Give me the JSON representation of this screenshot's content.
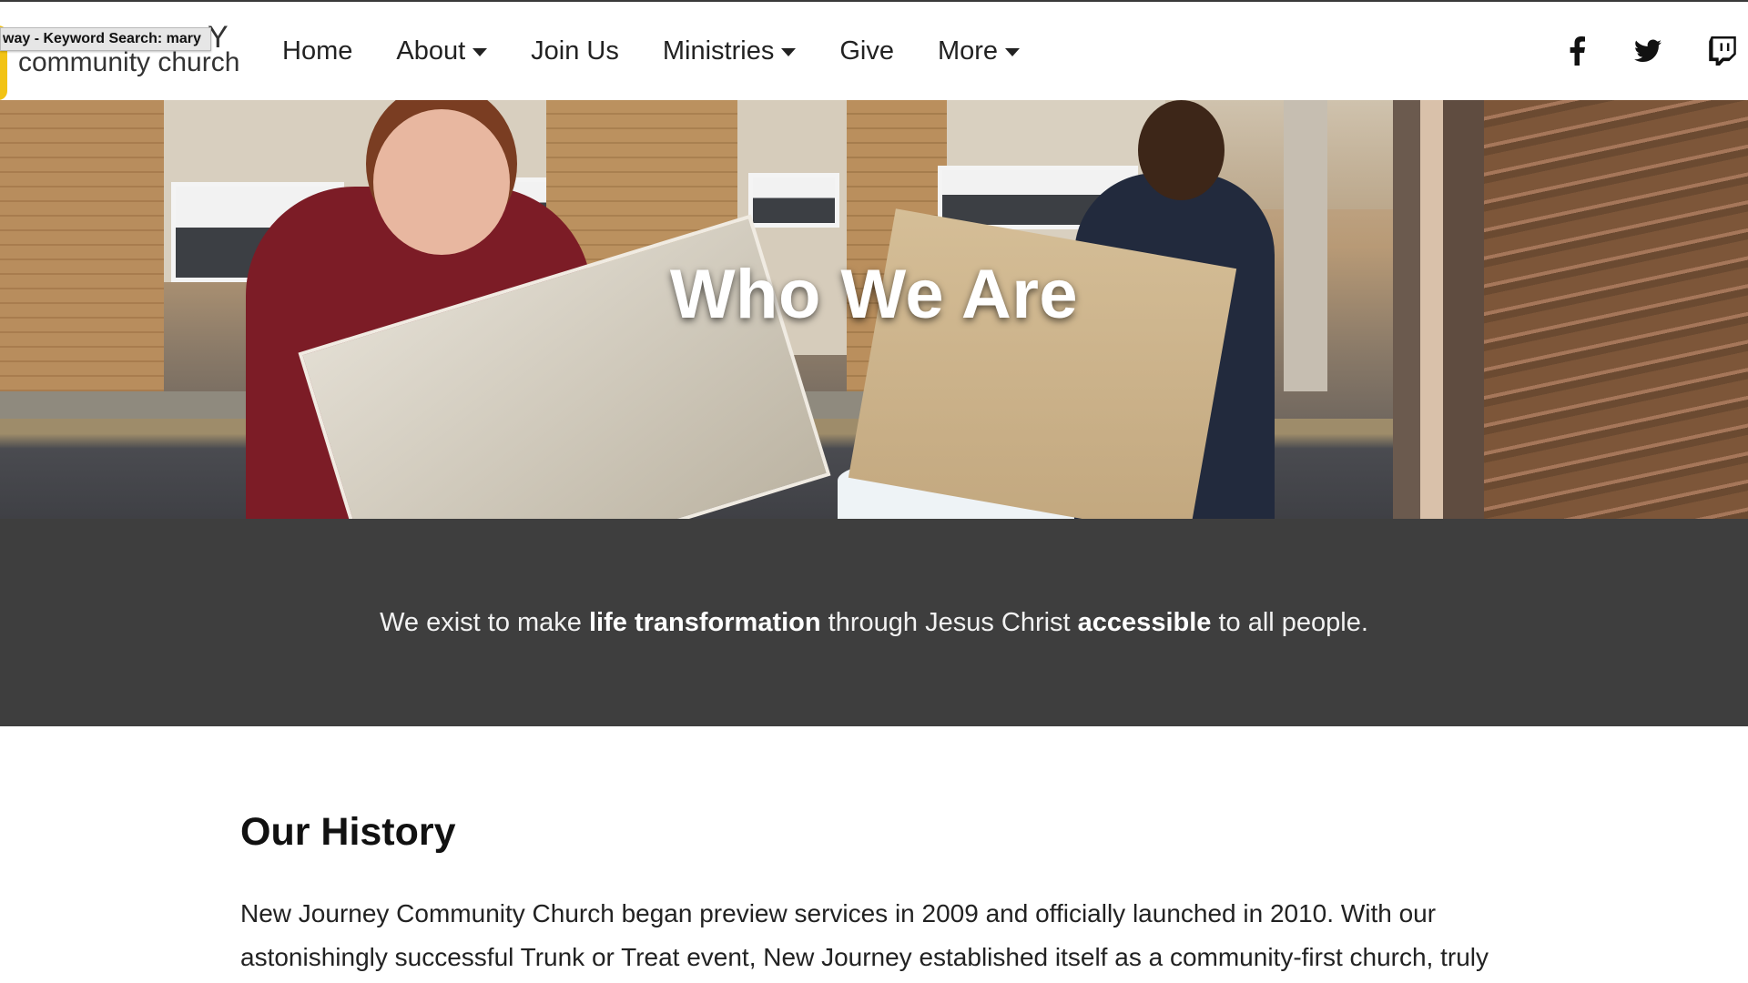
{
  "tooltip": "way - Keyword Search: mary",
  "logo": {
    "text_top": "Y",
    "text": "community church"
  },
  "nav": {
    "items": [
      {
        "label": "Home",
        "has_dropdown": false
      },
      {
        "label": "About",
        "has_dropdown": true
      },
      {
        "label": "Join Us",
        "has_dropdown": false
      },
      {
        "label": "Ministries",
        "has_dropdown": true
      },
      {
        "label": "Give",
        "has_dropdown": false
      },
      {
        "label": "More",
        "has_dropdown": true
      }
    ]
  },
  "social": {
    "icons": [
      "facebook-icon",
      "twitter-icon",
      "twitch-icon"
    ]
  },
  "hero": {
    "title": "Who We Are"
  },
  "mission": {
    "part1": "We exist to make ",
    "bold1": "life transformation",
    "part2": " through Jesus Christ ",
    "bold2": "accessible",
    "part3": " to all people."
  },
  "history": {
    "title": "Our History",
    "line1": "New Journey Community Church began preview services in 2009 and officially launched in 2010. With our",
    "line2": "astonishingly successful Trunk or Treat event, New Journey established itself as a community-first church, truly"
  },
  "colors": {
    "mission_bg": "#3e3e3e",
    "logo_accent": "#f2c314"
  }
}
